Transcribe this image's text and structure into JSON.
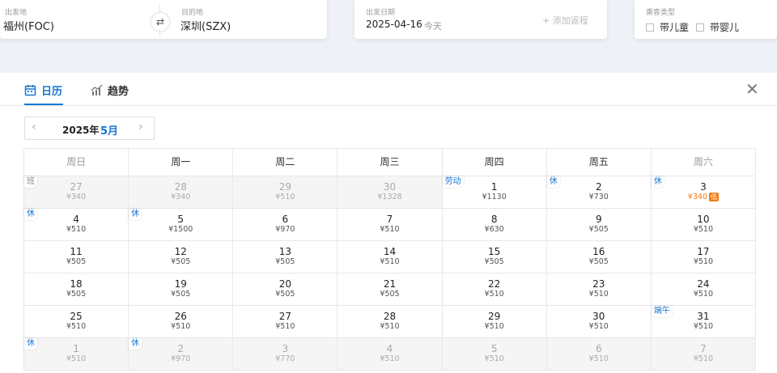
{
  "search": {
    "from_label": "出发地",
    "from_value": "福州(FOC)",
    "to_label": "目的地",
    "to_value": "深圳(SZX)",
    "swap_icon": "⇄",
    "date_label": "出发日期",
    "date_value": "2025-04-16",
    "date_hint": "今天",
    "add_return": "+ 添加返程",
    "pax_label": "乘客类型",
    "pax_child": "带儿童",
    "pax_infant": "带婴儿"
  },
  "tabs": {
    "calendar": "日历",
    "trend": "趋势"
  },
  "close_icon": "✕",
  "month": {
    "year": "2025年",
    "month": "5月",
    "prev": "‹",
    "next": "›"
  },
  "weekdays": [
    "周日",
    "周一",
    "周二",
    "周三",
    "周四",
    "周五",
    "周六"
  ],
  "weeks": [
    [
      {
        "day": "27",
        "price": "¥340",
        "other": true,
        "tag": "班",
        "tagType": "work"
      },
      {
        "day": "28",
        "price": "¥340",
        "other": true
      },
      {
        "day": "29",
        "price": "¥510",
        "other": true
      },
      {
        "day": "30",
        "price": "¥1328",
        "other": true
      },
      {
        "day": "1",
        "price": "¥1130",
        "tag": "劳动",
        "tagType": "holiday"
      },
      {
        "day": "2",
        "price": "¥730",
        "tag": "休",
        "tagType": "holiday"
      },
      {
        "day": "3",
        "price": "¥340",
        "tag": "休",
        "tagType": "holiday",
        "low": true,
        "badge": "低"
      }
    ],
    [
      {
        "day": "4",
        "price": "¥510",
        "tag": "休",
        "tagType": "holiday"
      },
      {
        "day": "5",
        "price": "¥1500",
        "tag": "休",
        "tagType": "holiday"
      },
      {
        "day": "6",
        "price": "¥970"
      },
      {
        "day": "7",
        "price": "¥510"
      },
      {
        "day": "8",
        "price": "¥630"
      },
      {
        "day": "9",
        "price": "¥505"
      },
      {
        "day": "10",
        "price": "¥510"
      }
    ],
    [
      {
        "day": "11",
        "price": "¥505"
      },
      {
        "day": "12",
        "price": "¥505"
      },
      {
        "day": "13",
        "price": "¥505"
      },
      {
        "day": "14",
        "price": "¥510"
      },
      {
        "day": "15",
        "price": "¥505"
      },
      {
        "day": "16",
        "price": "¥505"
      },
      {
        "day": "17",
        "price": "¥510"
      }
    ],
    [
      {
        "day": "18",
        "price": "¥505"
      },
      {
        "day": "19",
        "price": "¥505"
      },
      {
        "day": "20",
        "price": "¥505"
      },
      {
        "day": "21",
        "price": "¥505"
      },
      {
        "day": "22",
        "price": "¥510"
      },
      {
        "day": "23",
        "price": "¥510"
      },
      {
        "day": "24",
        "price": "¥510"
      }
    ],
    [
      {
        "day": "25",
        "price": "¥510"
      },
      {
        "day": "26",
        "price": "¥510"
      },
      {
        "day": "27",
        "price": "¥510"
      },
      {
        "day": "28",
        "price": "¥510"
      },
      {
        "day": "29",
        "price": "¥510"
      },
      {
        "day": "30",
        "price": "¥510"
      },
      {
        "day": "31",
        "price": "¥510",
        "tag": "端午",
        "tagType": "holiday"
      }
    ],
    [
      {
        "day": "1",
        "price": "¥510",
        "other": true,
        "tag": "休",
        "tagType": "holiday"
      },
      {
        "day": "2",
        "price": "¥970",
        "other": true,
        "tag": "休",
        "tagType": "holiday"
      },
      {
        "day": "3",
        "price": "¥770",
        "other": true
      },
      {
        "day": "4",
        "price": "¥510",
        "other": true
      },
      {
        "day": "5",
        "price": "¥510",
        "other": true
      },
      {
        "day": "6",
        "price": "¥510",
        "other": true
      },
      {
        "day": "7",
        "price": "¥510",
        "other": true
      }
    ]
  ],
  "colors": {
    "accent": "#1677d2",
    "low_price": "#f07b1a"
  }
}
